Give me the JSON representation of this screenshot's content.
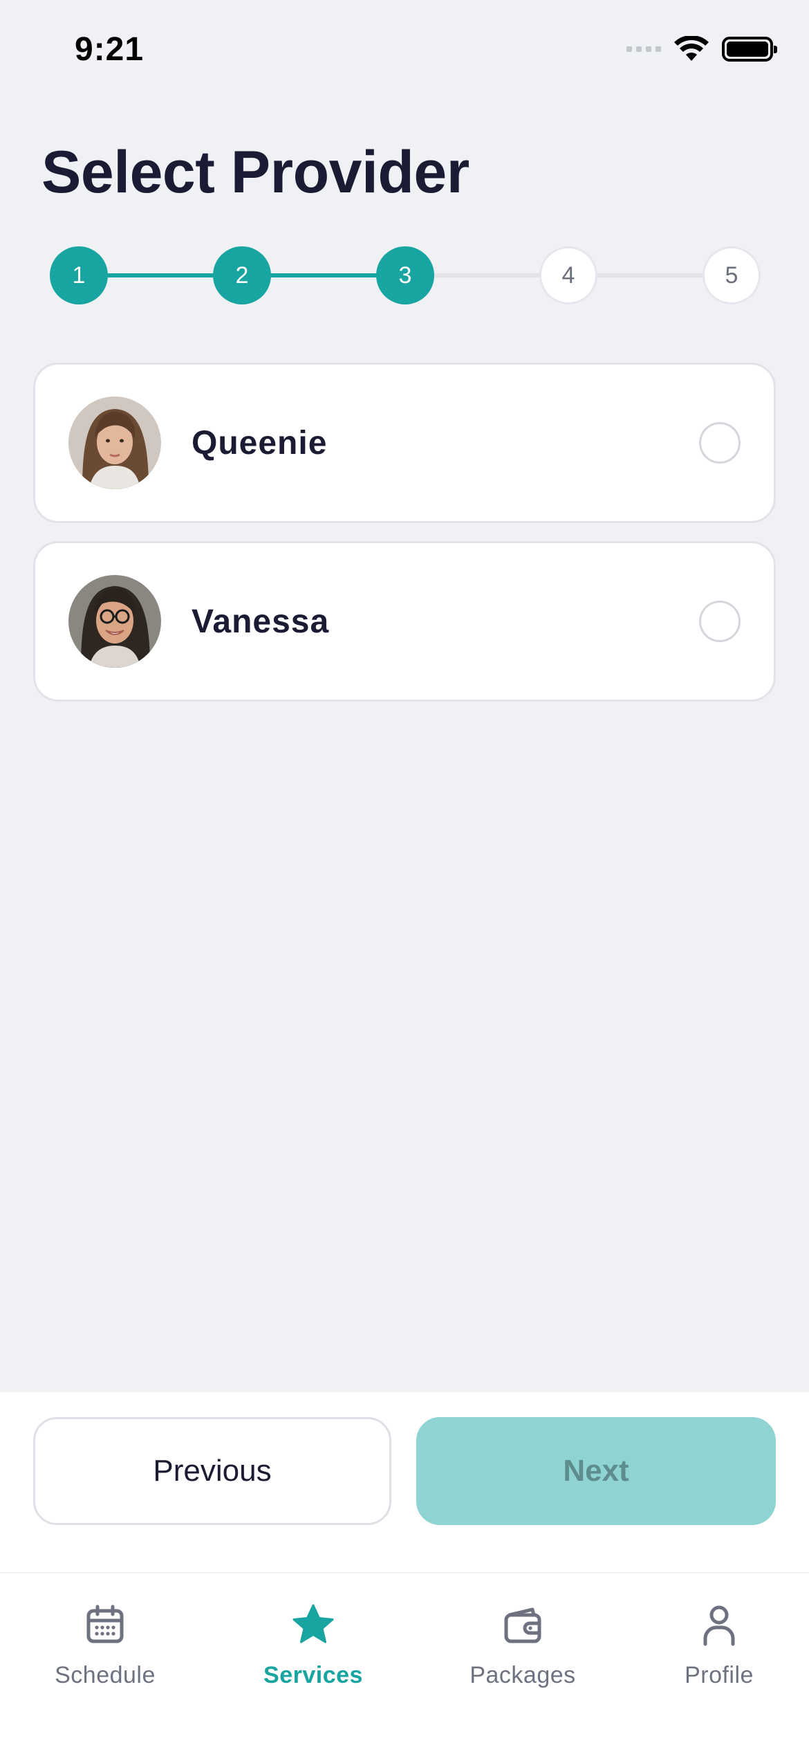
{
  "status_bar": {
    "time": "9:21"
  },
  "page": {
    "title": "Select Provider"
  },
  "stepper": {
    "steps": [
      {
        "label": "1",
        "state": "done"
      },
      {
        "label": "2",
        "state": "done"
      },
      {
        "label": "3",
        "state": "current"
      },
      {
        "label": "4",
        "state": "todo"
      },
      {
        "label": "5",
        "state": "todo"
      }
    ],
    "accent_color": "#18a4a0"
  },
  "providers": [
    {
      "name": "Queenie",
      "selected": false
    },
    {
      "name": "Vanessa",
      "selected": false
    }
  ],
  "actions": {
    "previous_label": "Previous",
    "next_label": "Next",
    "next_enabled": false
  },
  "tab_bar": {
    "items": [
      {
        "label": "Schedule",
        "icon": "calendar-icon",
        "active": false
      },
      {
        "label": "Services",
        "icon": "star-icon",
        "active": true
      },
      {
        "label": "Packages",
        "icon": "wallet-icon",
        "active": false
      },
      {
        "label": "Profile",
        "icon": "person-icon",
        "active": false
      }
    ]
  },
  "colors": {
    "accent": "#18a4a0",
    "accent_disabled": "#8fd4d2",
    "background": "#f0f1f5",
    "text": "#1b1b33"
  }
}
